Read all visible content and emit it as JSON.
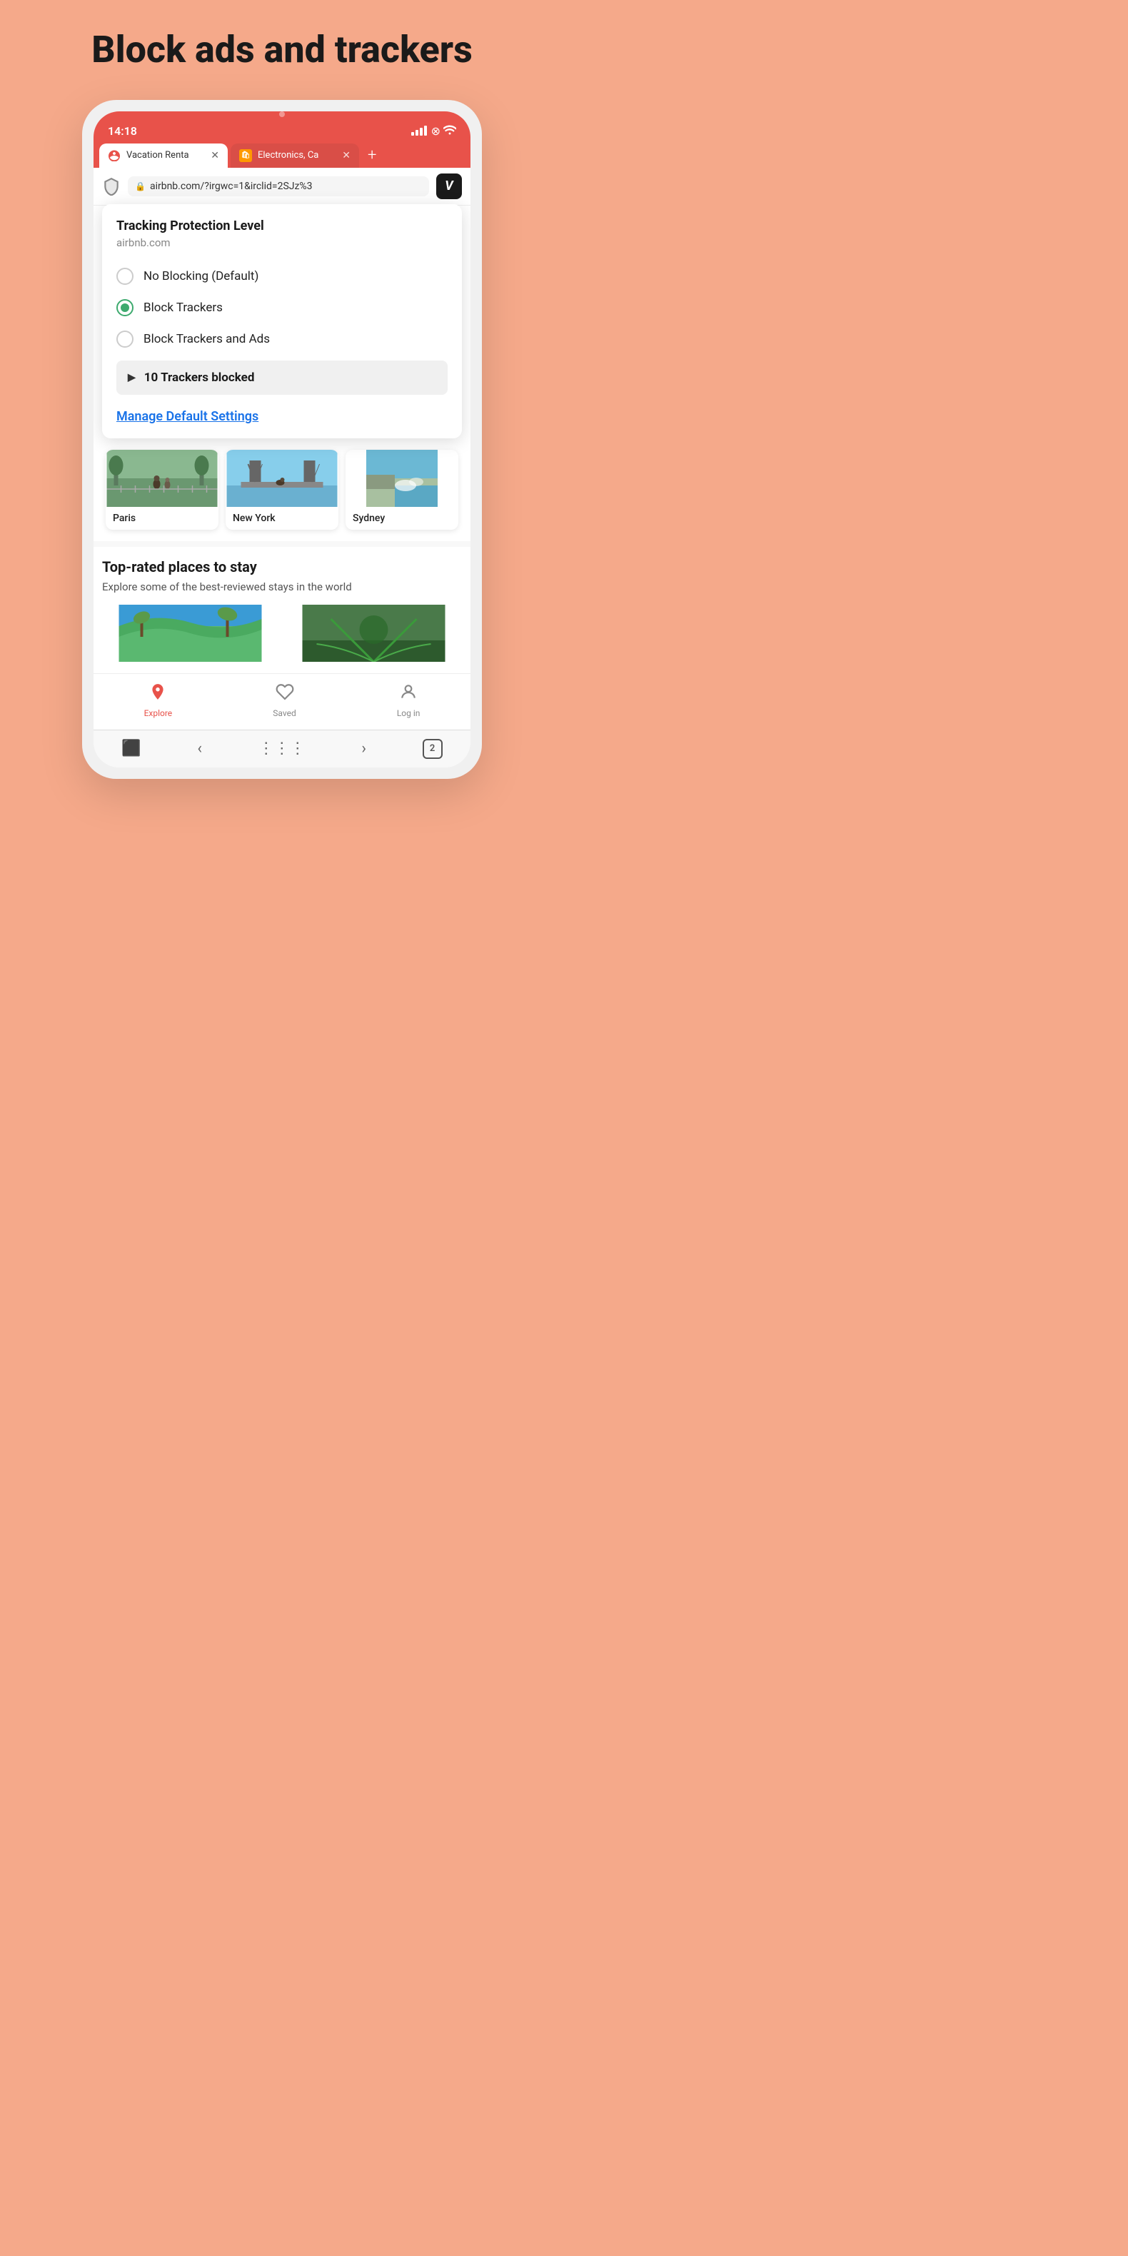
{
  "page": {
    "title": "Block ads and trackers",
    "background": "#f5a98a"
  },
  "phone": {
    "statusBar": {
      "time": "14:18"
    },
    "tabs": [
      {
        "favicon": "airbnb",
        "label": "Vacation Renta",
        "active": true
      },
      {
        "favicon": "amazon",
        "label": "Electronics, Ca",
        "active": false
      }
    ],
    "tabAddLabel": "+",
    "urlBar": {
      "url": "airbnb.com/?irgwc=1&irclid=2SJz%3",
      "vivaldiBtnLabel": "V"
    },
    "trackingPopup": {
      "title": "Tracking Protection Level",
      "domain": "airbnb.com",
      "options": [
        {
          "label": "No Blocking (Default)",
          "selected": false
        },
        {
          "label": "Block Trackers",
          "selected": true
        },
        {
          "label": "Block Trackers and Ads",
          "selected": false
        }
      ],
      "trackersBlocked": "10 Trackers blocked",
      "manageLink": "Manage Default Settings"
    },
    "destinations": [
      {
        "name": "Paris",
        "imgClass": "paris"
      },
      {
        "name": "New York",
        "imgClass": "newyork"
      },
      {
        "name": "Sydney",
        "imgClass": "sydney"
      }
    ],
    "topRated": {
      "title": "Top-rated places to stay",
      "subtitle": "Explore some of the best-reviewed stays in the world"
    },
    "bottomNav": [
      {
        "icon": "⌂",
        "label": "Explore",
        "active": true
      },
      {
        "icon": "♡",
        "label": "Saved",
        "active": false
      },
      {
        "icon": "◎",
        "label": "Log in",
        "active": false
      }
    ],
    "toolbar": {
      "tabCount": "2"
    }
  }
}
